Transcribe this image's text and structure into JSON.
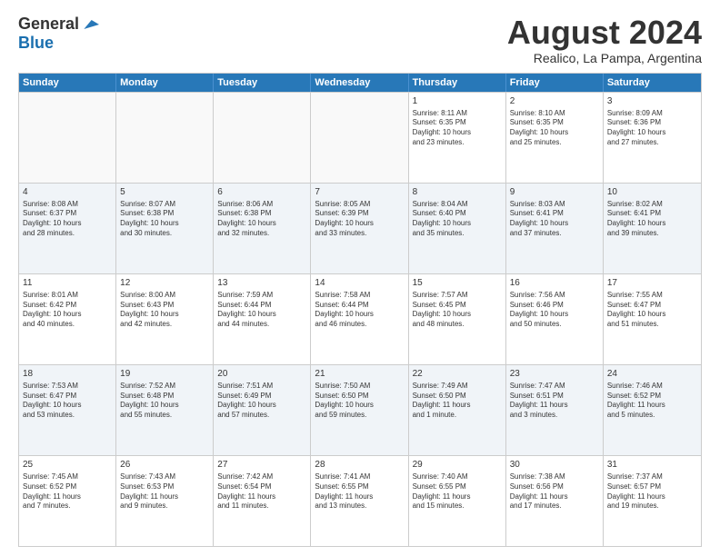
{
  "header": {
    "logo_general": "General",
    "logo_blue": "Blue",
    "month_title": "August 2024",
    "location": "Realico, La Pampa, Argentina"
  },
  "weekdays": [
    "Sunday",
    "Monday",
    "Tuesday",
    "Wednesday",
    "Thursday",
    "Friday",
    "Saturday"
  ],
  "rows": [
    [
      {
        "day": "",
        "text": "",
        "empty": true
      },
      {
        "day": "",
        "text": "",
        "empty": true
      },
      {
        "day": "",
        "text": "",
        "empty": true
      },
      {
        "day": "",
        "text": "",
        "empty": true
      },
      {
        "day": "1",
        "text": "Sunrise: 8:11 AM\nSunset: 6:35 PM\nDaylight: 10 hours\nand 23 minutes.",
        "empty": false
      },
      {
        "day": "2",
        "text": "Sunrise: 8:10 AM\nSunset: 6:35 PM\nDaylight: 10 hours\nand 25 minutes.",
        "empty": false
      },
      {
        "day": "3",
        "text": "Sunrise: 8:09 AM\nSunset: 6:36 PM\nDaylight: 10 hours\nand 27 minutes.",
        "empty": false
      }
    ],
    [
      {
        "day": "4",
        "text": "Sunrise: 8:08 AM\nSunset: 6:37 PM\nDaylight: 10 hours\nand 28 minutes.",
        "empty": false
      },
      {
        "day": "5",
        "text": "Sunrise: 8:07 AM\nSunset: 6:38 PM\nDaylight: 10 hours\nand 30 minutes.",
        "empty": false
      },
      {
        "day": "6",
        "text": "Sunrise: 8:06 AM\nSunset: 6:38 PM\nDaylight: 10 hours\nand 32 minutes.",
        "empty": false
      },
      {
        "day": "7",
        "text": "Sunrise: 8:05 AM\nSunset: 6:39 PM\nDaylight: 10 hours\nand 33 minutes.",
        "empty": false
      },
      {
        "day": "8",
        "text": "Sunrise: 8:04 AM\nSunset: 6:40 PM\nDaylight: 10 hours\nand 35 minutes.",
        "empty": false
      },
      {
        "day": "9",
        "text": "Sunrise: 8:03 AM\nSunset: 6:41 PM\nDaylight: 10 hours\nand 37 minutes.",
        "empty": false
      },
      {
        "day": "10",
        "text": "Sunrise: 8:02 AM\nSunset: 6:41 PM\nDaylight: 10 hours\nand 39 minutes.",
        "empty": false
      }
    ],
    [
      {
        "day": "11",
        "text": "Sunrise: 8:01 AM\nSunset: 6:42 PM\nDaylight: 10 hours\nand 40 minutes.",
        "empty": false
      },
      {
        "day": "12",
        "text": "Sunrise: 8:00 AM\nSunset: 6:43 PM\nDaylight: 10 hours\nand 42 minutes.",
        "empty": false
      },
      {
        "day": "13",
        "text": "Sunrise: 7:59 AM\nSunset: 6:44 PM\nDaylight: 10 hours\nand 44 minutes.",
        "empty": false
      },
      {
        "day": "14",
        "text": "Sunrise: 7:58 AM\nSunset: 6:44 PM\nDaylight: 10 hours\nand 46 minutes.",
        "empty": false
      },
      {
        "day": "15",
        "text": "Sunrise: 7:57 AM\nSunset: 6:45 PM\nDaylight: 10 hours\nand 48 minutes.",
        "empty": false
      },
      {
        "day": "16",
        "text": "Sunrise: 7:56 AM\nSunset: 6:46 PM\nDaylight: 10 hours\nand 50 minutes.",
        "empty": false
      },
      {
        "day": "17",
        "text": "Sunrise: 7:55 AM\nSunset: 6:47 PM\nDaylight: 10 hours\nand 51 minutes.",
        "empty": false
      }
    ],
    [
      {
        "day": "18",
        "text": "Sunrise: 7:53 AM\nSunset: 6:47 PM\nDaylight: 10 hours\nand 53 minutes.",
        "empty": false
      },
      {
        "day": "19",
        "text": "Sunrise: 7:52 AM\nSunset: 6:48 PM\nDaylight: 10 hours\nand 55 minutes.",
        "empty": false
      },
      {
        "day": "20",
        "text": "Sunrise: 7:51 AM\nSunset: 6:49 PM\nDaylight: 10 hours\nand 57 minutes.",
        "empty": false
      },
      {
        "day": "21",
        "text": "Sunrise: 7:50 AM\nSunset: 6:50 PM\nDaylight: 10 hours\nand 59 minutes.",
        "empty": false
      },
      {
        "day": "22",
        "text": "Sunrise: 7:49 AM\nSunset: 6:50 PM\nDaylight: 11 hours\nand 1 minute.",
        "empty": false
      },
      {
        "day": "23",
        "text": "Sunrise: 7:47 AM\nSunset: 6:51 PM\nDaylight: 11 hours\nand 3 minutes.",
        "empty": false
      },
      {
        "day": "24",
        "text": "Sunrise: 7:46 AM\nSunset: 6:52 PM\nDaylight: 11 hours\nand 5 minutes.",
        "empty": false
      }
    ],
    [
      {
        "day": "25",
        "text": "Sunrise: 7:45 AM\nSunset: 6:52 PM\nDaylight: 11 hours\nand 7 minutes.",
        "empty": false
      },
      {
        "day": "26",
        "text": "Sunrise: 7:43 AM\nSunset: 6:53 PM\nDaylight: 11 hours\nand 9 minutes.",
        "empty": false
      },
      {
        "day": "27",
        "text": "Sunrise: 7:42 AM\nSunset: 6:54 PM\nDaylight: 11 hours\nand 11 minutes.",
        "empty": false
      },
      {
        "day": "28",
        "text": "Sunrise: 7:41 AM\nSunset: 6:55 PM\nDaylight: 11 hours\nand 13 minutes.",
        "empty": false
      },
      {
        "day": "29",
        "text": "Sunrise: 7:40 AM\nSunset: 6:55 PM\nDaylight: 11 hours\nand 15 minutes.",
        "empty": false
      },
      {
        "day": "30",
        "text": "Sunrise: 7:38 AM\nSunset: 6:56 PM\nDaylight: 11 hours\nand 17 minutes.",
        "empty": false
      },
      {
        "day": "31",
        "text": "Sunrise: 7:37 AM\nSunset: 6:57 PM\nDaylight: 11 hours\nand 19 minutes.",
        "empty": false
      }
    ]
  ]
}
